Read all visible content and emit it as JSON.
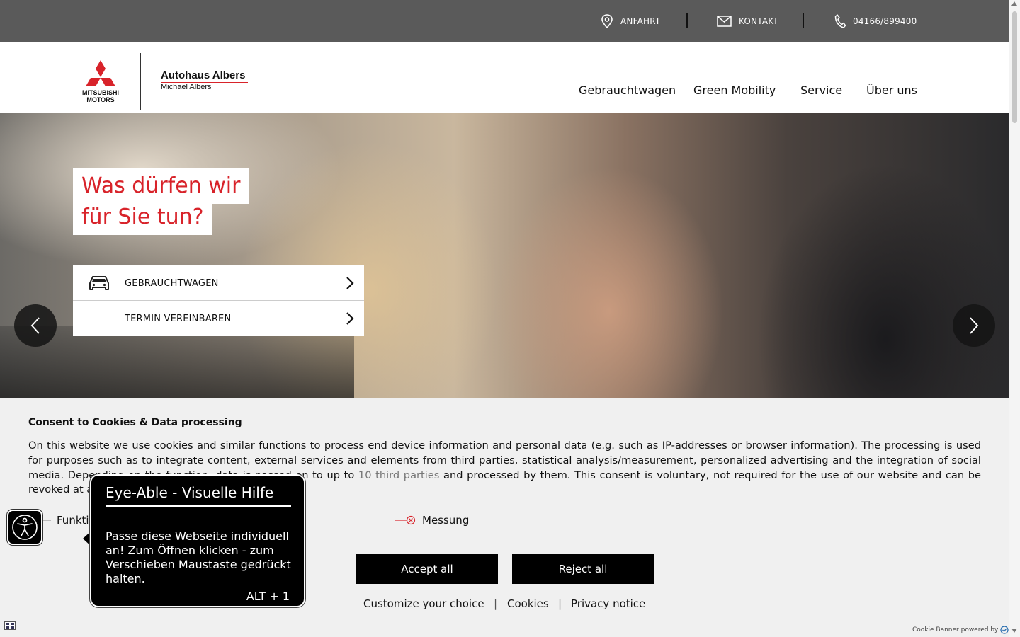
{
  "topbar": {
    "directions": "ANFAHRT",
    "contact": "KONTAKT",
    "phone": "04166/899400"
  },
  "header": {
    "brand_line1": "MITSUBISHI",
    "brand_line2": "MOTORS",
    "dealer_name": "Autohaus Albers",
    "dealer_owner": "Michael Albers",
    "nav": [
      "Gebrauchtwagen",
      "Green Mobility",
      "Service",
      "Über uns"
    ]
  },
  "hero": {
    "headline_line1": "Was dürfen wir",
    "headline_line2": "für Sie tun?",
    "cta_used_cars": "GEBRAUCHTWAGEN",
    "cta_appointment": "TERMIN VEREINBAREN"
  },
  "cookie": {
    "title": "Consent to Cookies & Data processing",
    "text_before": "On this website we use cookies and similar functions to process end device information and personal data (e.g. such as IP-addresses or browser information). The processing is used for purposes such as to integrate content, external services and elements from third parties, statistical analysis/measurement, personalized advertising and the integration of social media. Depending on the function, data is passed on to up to ",
    "third_parties": "10 third parties",
    "text_after": " and processed by them. This consent is voluntary, not required for the use of our website and can be revoked at any time via the icon on the bottom left.",
    "categories": [
      "Funktional",
      "Messung"
    ],
    "accept_all": "Accept all",
    "reject_all": "Reject all",
    "customize": "Customize your choice",
    "cookies": "Cookies",
    "privacy": "Privacy notice",
    "link_separator": "|",
    "powered_by": "Cookie Banner powered by"
  },
  "eyeable": {
    "title": "Eye-Able - Visuelle Hilfe",
    "body": "Passe diese Webseite individuell an! Zum Öffnen klicken - zum Verschieben Maustaste gedrückt halten.",
    "shortcut": "ALT + 1"
  },
  "colors": {
    "brand_red": "#d8232a",
    "topbar_bg": "#5a5a5a",
    "cookie_bg": "#f0f0f0"
  }
}
